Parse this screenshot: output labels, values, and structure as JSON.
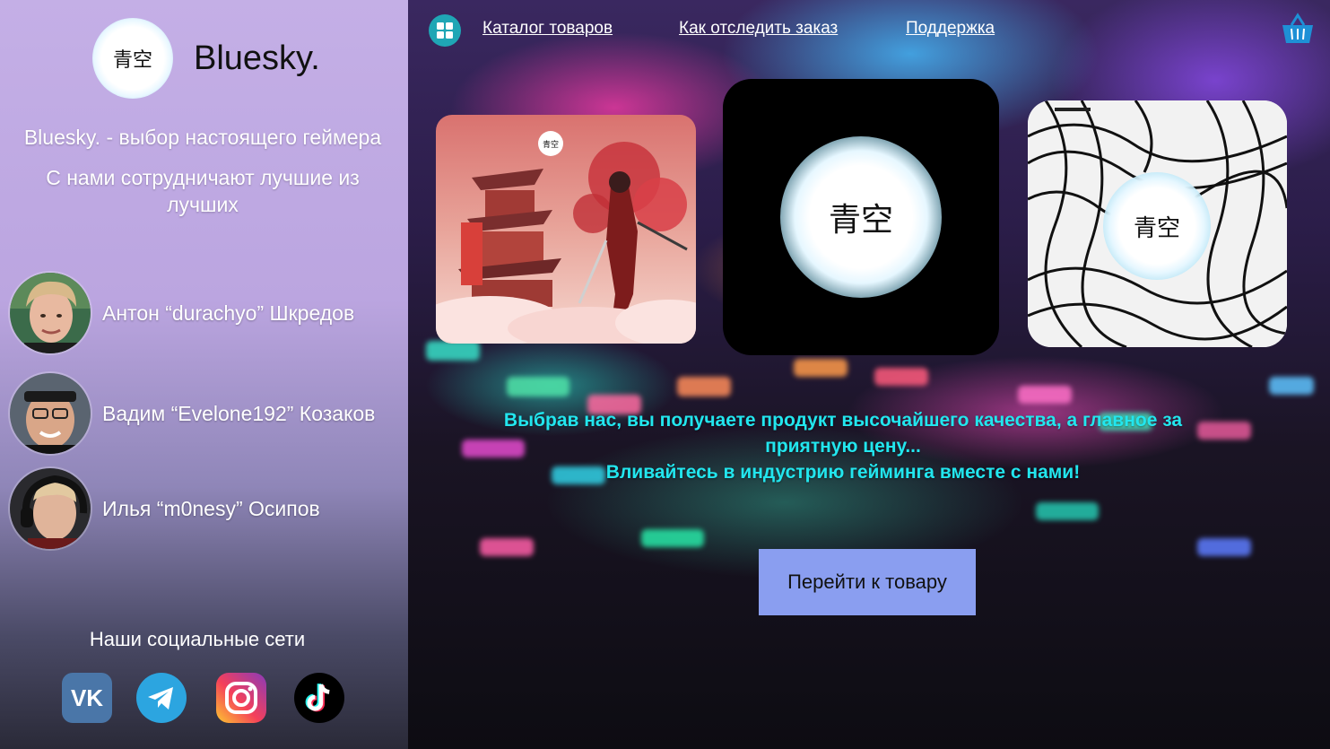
{
  "sidebar": {
    "logo_glyph": "青空",
    "brand": "Bluesky.",
    "tagline": "Bluesky. - выбор настоящего геймера",
    "subtagline": "С нами сотрудничают лучшие из лучших",
    "players": [
      {
        "name": "Антон “durachyo” Шкредов"
      },
      {
        "name": "Вадим “Evelone192” Козаков"
      },
      {
        "name": "Илья “m0nesy” Осипов"
      }
    ],
    "social_title": "Наши социальные сети",
    "socials": [
      {
        "icon": "vk-icon",
        "color": "#4a76a8"
      },
      {
        "icon": "telegram-icon",
        "color": "#2ca5e0"
      },
      {
        "icon": "instagram-icon",
        "color": "#d6249f"
      },
      {
        "icon": "tiktok-icon",
        "color": "#000000"
      }
    ]
  },
  "nav": {
    "menu_icon": "grid-icon",
    "links": [
      "Каталог товаров",
      "Как отследить заказ",
      "Поддержка"
    ],
    "cart_icon": "basket-icon"
  },
  "products": [
    {
      "image": "samurai-mousepad",
      "badge": "青空"
    },
    {
      "image": "black-logo-mousepad",
      "badge": "青空"
    },
    {
      "image": "topographic-mousepad",
      "badge": "青空"
    }
  ],
  "promo": {
    "line1": "Выбрав нас, вы получаете продукт высочайшего качества, а главное за приятную цену...",
    "line2": "Вливайтесь в индустрию гейминга вместе с нами!"
  },
  "cta_label": "Перейти к товару",
  "colors": {
    "accent": "#22e6ee",
    "cta": "#8a9ef0",
    "menu_button": "#1fa6b5",
    "cart": "#1e90d6"
  }
}
